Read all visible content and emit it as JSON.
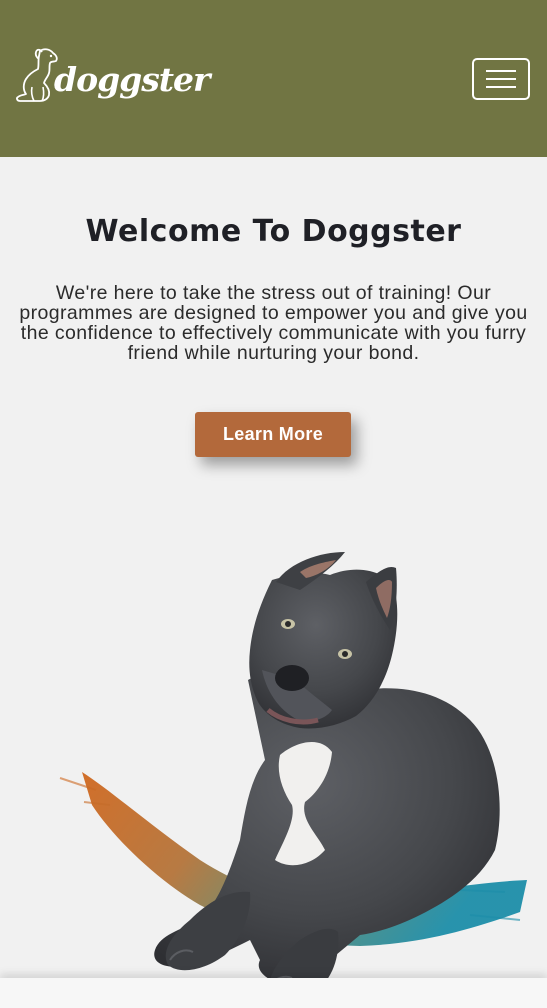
{
  "header": {
    "logo_text": "doggster",
    "menu_icon": "hamburger-menu-icon",
    "background_color": "#717543"
  },
  "hero": {
    "title": "Welcome To Doggster",
    "description": "We're here to take the stress out of training! Our programmes are designed to empower you and give you the confidence to effectively communicate with you furry friend while nurturing your bond.",
    "cta_label": "Learn More",
    "cta_color": "#b3693b",
    "image_icon": "dog-photo"
  }
}
